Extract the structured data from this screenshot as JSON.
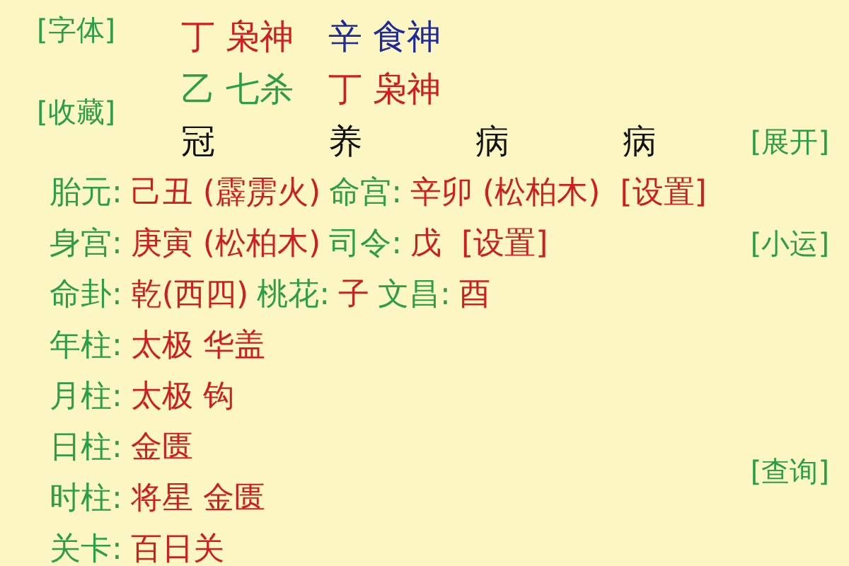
{
  "side_buttons": [
    {
      "text": "[字体]"
    },
    {
      "text": "[收藏]"
    }
  ],
  "pillar_rows": [
    {
      "cells": [
        {
          "text": "丁 枭神",
          "color": "#cc2020"
        },
        {
          "text": "辛 食神",
          "color": "#1f2a99"
        }
      ]
    },
    {
      "cells": [
        {
          "text": "乙 七杀",
          "color": "#2e9d4a"
        },
        {
          "text": "丁 枭神",
          "color": "#cc2020"
        }
      ]
    }
  ],
  "life_stages": [
    "冠",
    "养",
    "病",
    "病"
  ],
  "expand_button": "[展开]",
  "info_lines": [
    {
      "segments": [
        {
          "kind": "label",
          "text": "胎元:"
        },
        {
          "kind": "value",
          "text": "己丑 (霹雳火)"
        },
        {
          "kind": "label",
          "text": "命宫:"
        },
        {
          "kind": "value",
          "text": "辛卯 (松柏木)"
        },
        {
          "kind": "link",
          "text": "[设置]"
        }
      ]
    },
    {
      "segments": [
        {
          "kind": "label",
          "text": "身宫:"
        },
        {
          "kind": "value",
          "text": "庚寅 (松柏木)"
        },
        {
          "kind": "label",
          "text": "司令:"
        },
        {
          "kind": "value",
          "text": "戊"
        },
        {
          "kind": "link",
          "text": "[设置]"
        }
      ],
      "side_button": "[小运]"
    },
    {
      "segments": [
        {
          "kind": "label",
          "text": "命卦:"
        },
        {
          "kind": "value",
          "text": "乾(西四)"
        },
        {
          "kind": "label",
          "text": "桃花:"
        },
        {
          "kind": "value",
          "text": "子"
        },
        {
          "kind": "label",
          "text": "文昌:"
        },
        {
          "kind": "value",
          "text": "酉"
        }
      ]
    },
    {
      "segments": [
        {
          "kind": "label",
          "text": "年柱:"
        },
        {
          "kind": "value",
          "text": "太极 华盖"
        }
      ]
    },
    {
      "segments": [
        {
          "kind": "label",
          "text": "月柱:"
        },
        {
          "kind": "value",
          "text": "太极 钩"
        }
      ]
    },
    {
      "segments": [
        {
          "kind": "label",
          "text": "日柱:"
        },
        {
          "kind": "value",
          "text": "金匮"
        }
      ],
      "side_button": "[查询]"
    },
    {
      "segments": [
        {
          "kind": "label",
          "text": "时柱:"
        },
        {
          "kind": "value",
          "text": "将星 金匮"
        }
      ]
    },
    {
      "segments": [
        {
          "kind": "label",
          "text": "关卡:"
        },
        {
          "kind": "value",
          "text": "百日关"
        }
      ]
    }
  ]
}
